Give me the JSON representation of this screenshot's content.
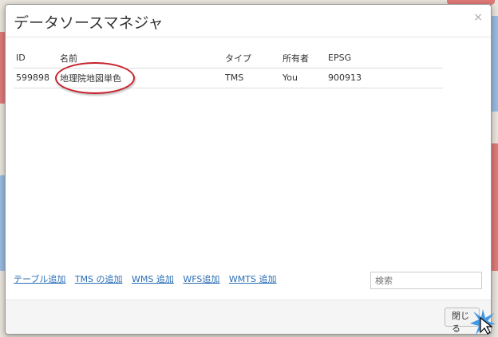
{
  "window": {
    "title": "データソースマネジャ",
    "close_symbol": "×"
  },
  "table": {
    "headers": [
      "ID",
      "名前",
      "タイプ",
      "所有者",
      "EPSG"
    ],
    "rows": [
      {
        "id": "599898",
        "name": "地理院地図単色",
        "type": "TMS",
        "owner": "You",
        "epsg": "900913"
      }
    ]
  },
  "links": {
    "add_table": "テーブル追加",
    "add_tms": "TMS の追加",
    "add_wms": "WMS 追加",
    "add_wfs": "WFS追加",
    "add_wmts": "WMTS 追加"
  },
  "search": {
    "placeholder": "検索"
  },
  "footer": {
    "close_label": "閉じる"
  },
  "colors": {
    "link": "#2a6db5",
    "highlight": "#c8202a"
  }
}
